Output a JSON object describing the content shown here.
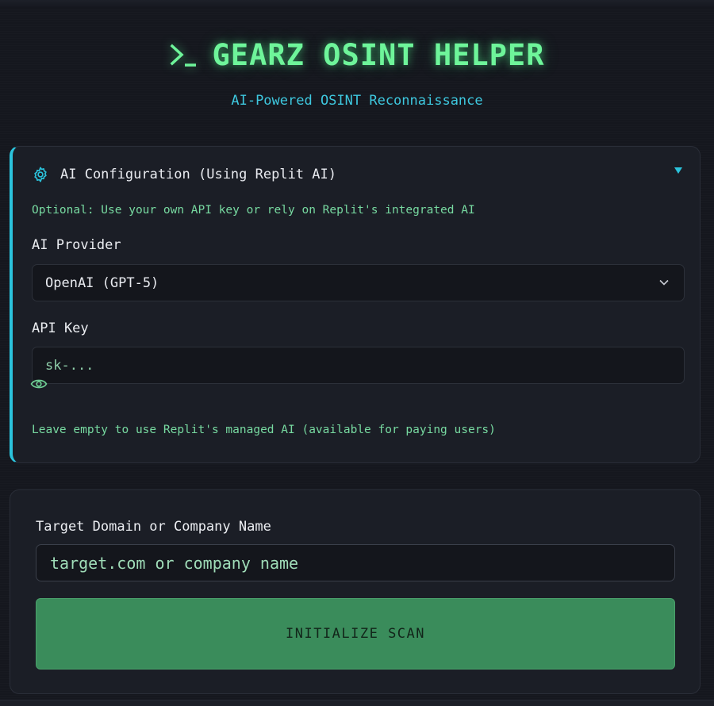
{
  "header": {
    "title": "GEARZ OSINT HELPER",
    "subtitle": "AI-Powered OSINT Reconnaissance",
    "prompt_icon": "terminal-prompt-icon"
  },
  "config": {
    "title": "AI Configuration (Using Replit AI)",
    "icon": "gear-icon",
    "toggle_icon": "triangle-down-icon",
    "description": "Optional: Use your own API key or rely on Replit's integrated AI",
    "provider_label": "AI Provider",
    "provider_value": "OpenAI (GPT-5)",
    "api_key_label": "API Key",
    "api_key_placeholder": "sk-...",
    "api_key_value": "",
    "visibility_icon": "eye-icon",
    "note": "Leave empty to use Replit's managed AI (available for paying users)"
  },
  "scan": {
    "target_label": "Target Domain or Company Name",
    "target_placeholder": "target.com or company name",
    "target_value": "",
    "button_label": "INITIALIZE SCAN"
  },
  "colors": {
    "accent_green": "#6ef59a",
    "accent_cyan": "#2bc3dc",
    "button_green": "#3a8c5b",
    "background": "#15171e"
  }
}
